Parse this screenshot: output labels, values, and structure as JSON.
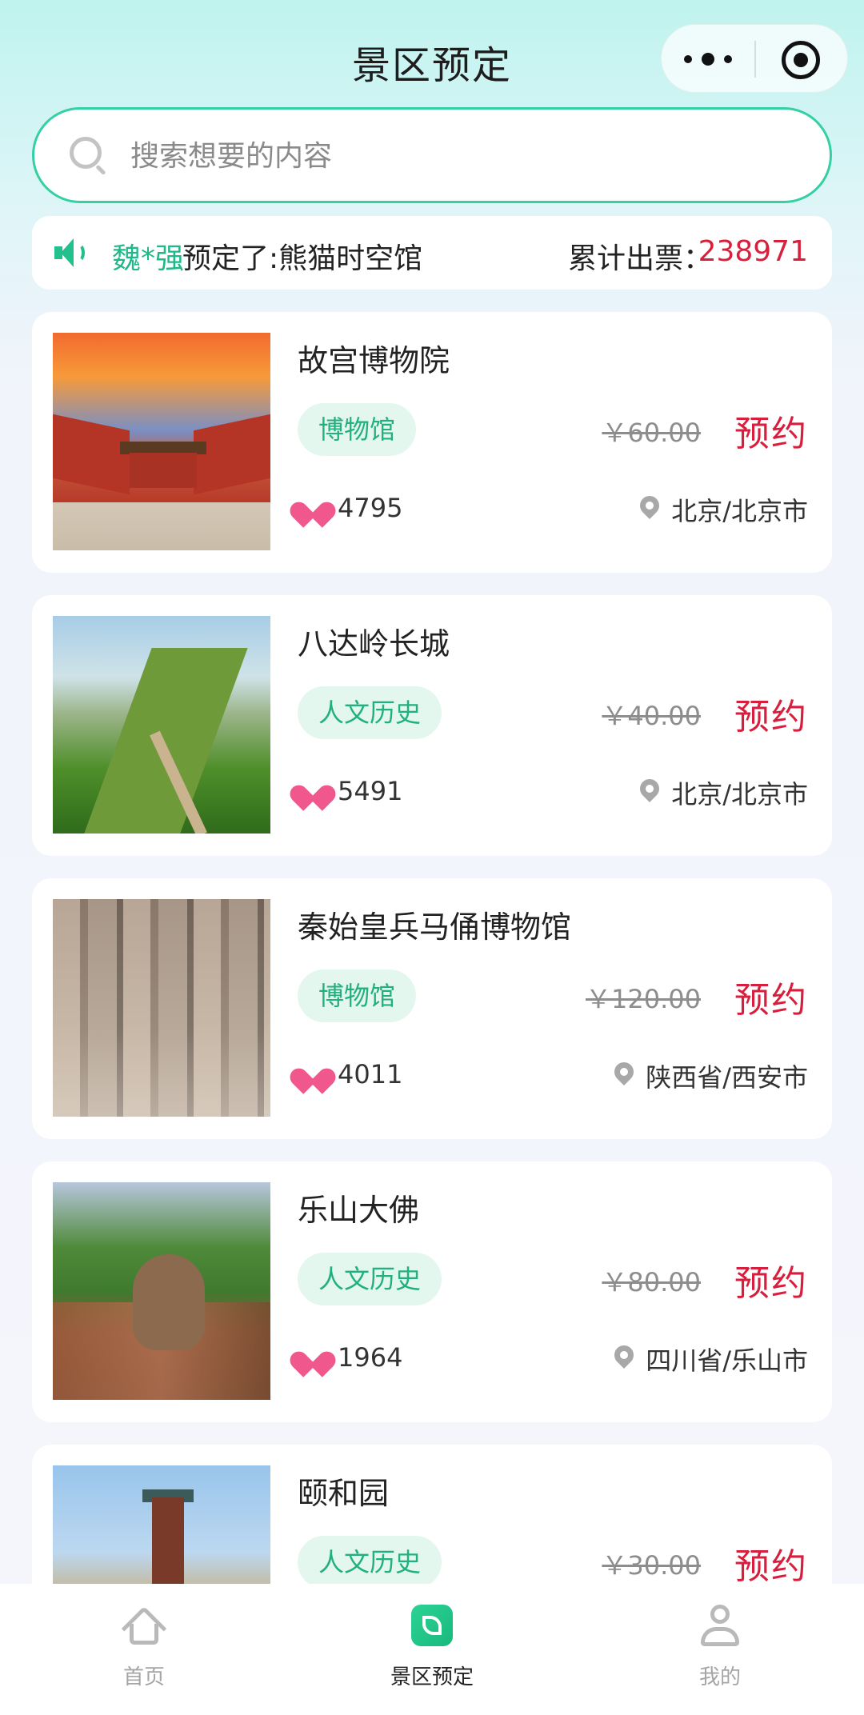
{
  "header": {
    "title": "景区预定"
  },
  "search": {
    "placeholder": "搜索想要的内容",
    "value": ""
  },
  "notice": {
    "who": "魏*强",
    "message": "预定了:熊猫时空馆",
    "total_label": "累计出票：",
    "total_value": "238971"
  },
  "spots": [
    {
      "name": "故宫博物院",
      "tag": "博物馆",
      "price": "￥60.00",
      "book": "预约",
      "likes": "4795",
      "location": "北京/北京市"
    },
    {
      "name": "八达岭长城",
      "tag": "人文历史",
      "price": "￥40.00",
      "book": "预约",
      "likes": "5491",
      "location": "北京/北京市"
    },
    {
      "name": "秦始皇兵马俑博物馆",
      "tag": "博物馆",
      "price": "￥120.00",
      "book": "预约",
      "likes": "4011",
      "location": "陕西省/西安市"
    },
    {
      "name": "乐山大佛",
      "tag": "人文历史",
      "price": "￥80.00",
      "book": "预约",
      "likes": "1964",
      "location": "四川省/乐山市"
    },
    {
      "name": "颐和园",
      "tag": "人文历史",
      "price": "￥30.00",
      "book": "预约",
      "likes": "",
      "location": ""
    }
  ],
  "tabbar": {
    "home": "首页",
    "book": "景区预定",
    "mine": "我的",
    "active": "book"
  },
  "colors": {
    "accent": "#22c08d",
    "price_red": "#d91d3c",
    "like_pink": "#f0588d"
  },
  "icons": [
    "more-icon",
    "target-icon",
    "search-icon",
    "speaker-icon",
    "heart-icon",
    "location-pin-icon",
    "home-icon",
    "leaf-icon",
    "user-icon"
  ]
}
